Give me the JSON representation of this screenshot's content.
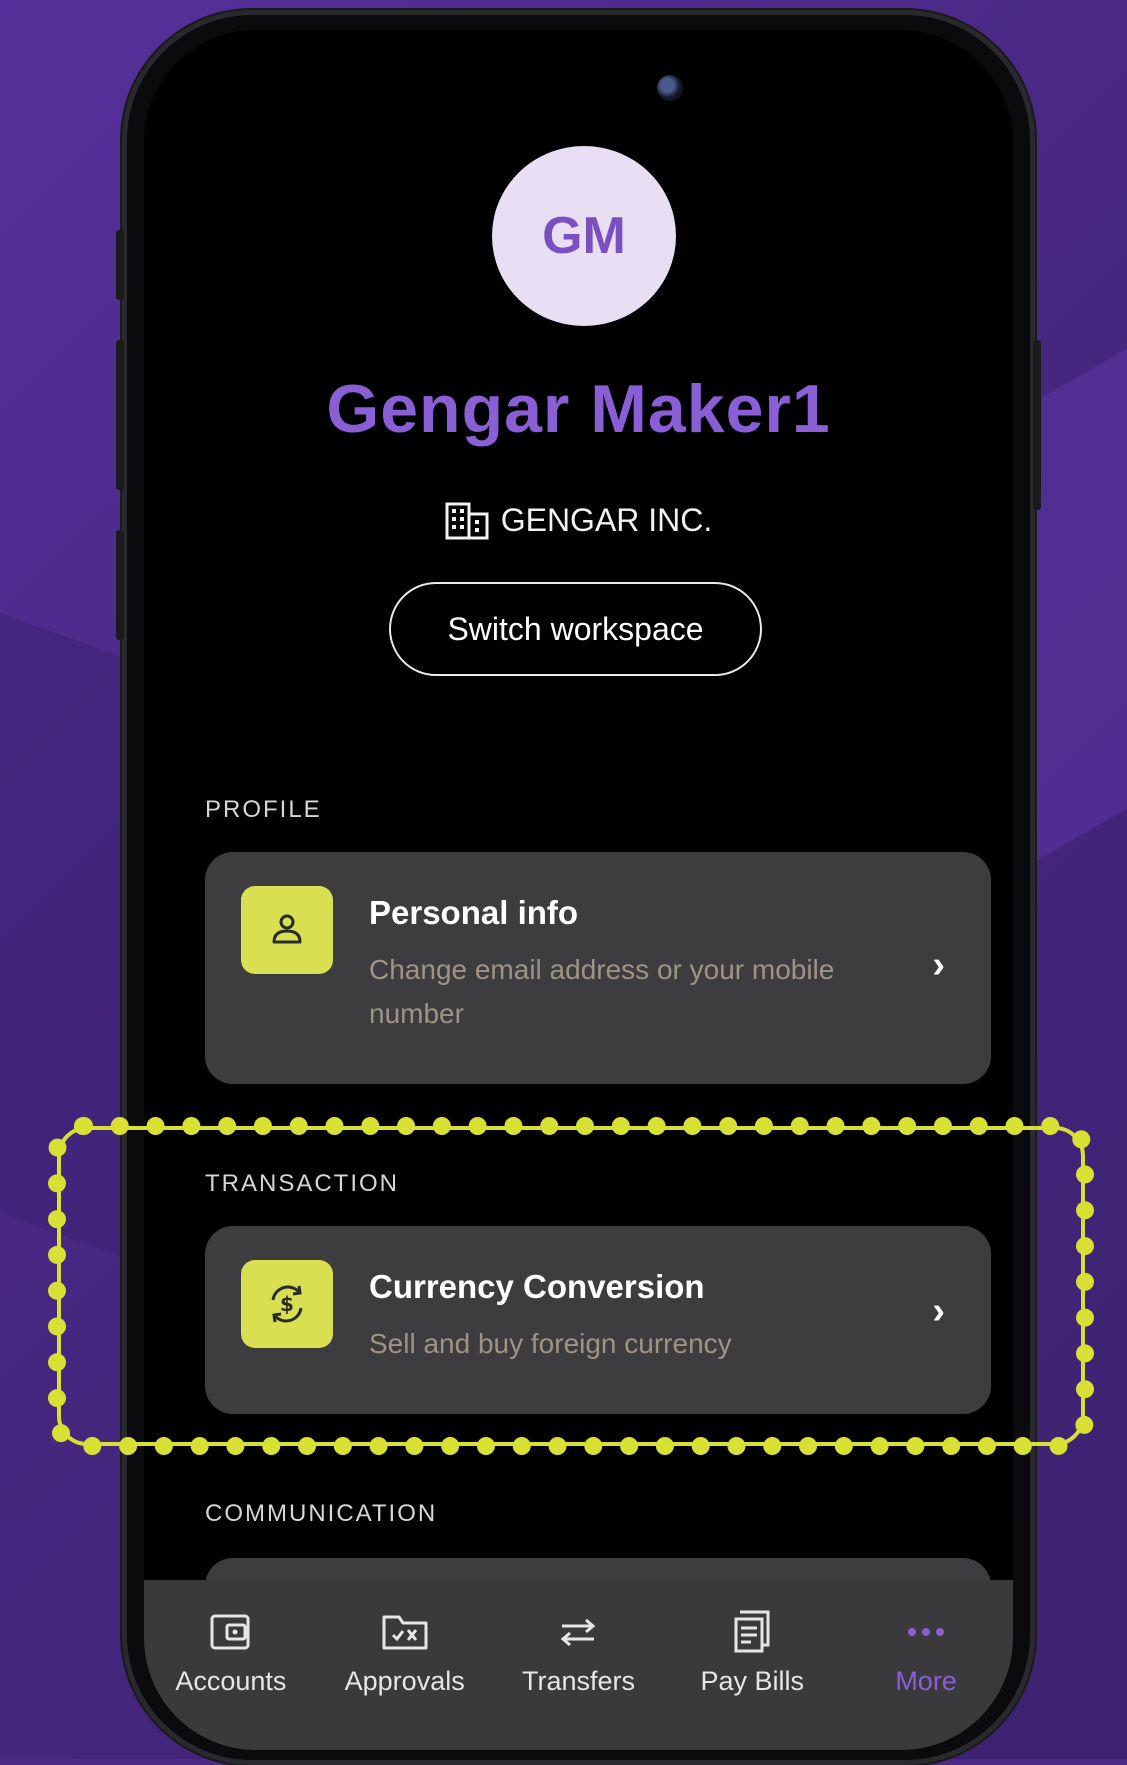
{
  "user": {
    "initials": "GM",
    "name": "Gengar Maker1",
    "company": "GENGAR INC.",
    "switch_label": "Switch workspace"
  },
  "sections": {
    "profile": {
      "label": "PROFILE",
      "item": {
        "title": "Personal info",
        "subtitle": "Change email address or your mobile number",
        "icon": "person-icon"
      }
    },
    "transaction": {
      "label": "TRANSACTION",
      "item": {
        "title": "Currency Conversion",
        "subtitle": "Sell and buy foreign currency",
        "icon": "currency-exchange-icon"
      }
    },
    "communication": {
      "label": "COMMUNICATION"
    }
  },
  "tabbar": {
    "items": [
      {
        "label": "Accounts",
        "icon": "wallet-icon"
      },
      {
        "label": "Approvals",
        "icon": "folder-check-icon"
      },
      {
        "label": "Transfers",
        "icon": "transfer-arrows-icon"
      },
      {
        "label": "Pay Bills",
        "icon": "bill-icon"
      },
      {
        "label": "More",
        "icon": "more-dots-icon",
        "active": true
      }
    ]
  },
  "colors": {
    "accent": "#8a5fd6",
    "highlight": "#d9e034",
    "card": "#3d3d3f",
    "background": "#4a2a86"
  }
}
